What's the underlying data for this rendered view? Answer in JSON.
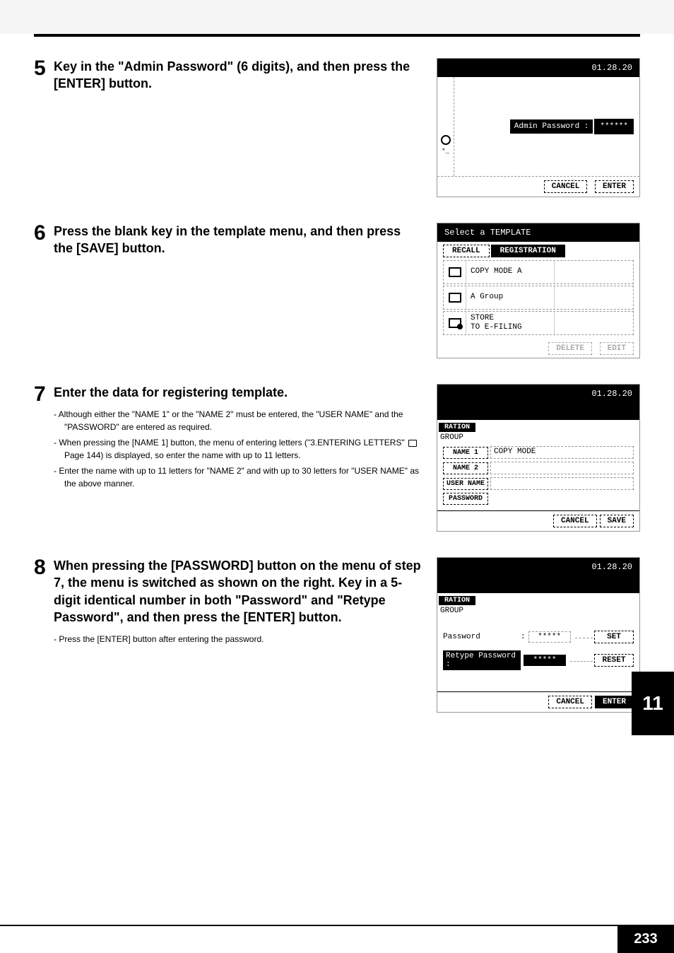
{
  "steps": {
    "5": {
      "num": "5",
      "title": "Key in the \"Admin Password\" (6 digits), and then press the [ENTER] button.",
      "screen": {
        "timestamp": "01.28.20",
        "label": "Admin Password :",
        "value": "******",
        "cancel": "CANCEL",
        "enter": "ENTER"
      }
    },
    "6": {
      "num": "6",
      "title": "Press the blank key in the template menu, and then press the [SAVE] button.",
      "screen": {
        "header": "Select a TEMPLATE",
        "tab_recall": "RECALL",
        "tab_registration": "REGISTRATION",
        "row1": "COPY MODE A",
        "row2": "A Group",
        "row3a": "STORE",
        "row3b": "TO E-FILING",
        "delete": "DELETE",
        "edit": "EDIT"
      }
    },
    "7": {
      "num": "7",
      "title": "Enter the data for registering template.",
      "bullets": {
        "b1": "Although either the \"NAME 1\" or the \"NAME 2\" must be entered, the \"USER NAME\" and the \"PASSWORD\" are entered as required.",
        "b2a": "When pressing the [NAME 1] button, the menu of entering letters (\"3.ENTERING LETTERS\" ",
        "b2b": " Page 144) is displayed, so enter the name with up to 11 letters.",
        "b3": "Enter the name with up to 11 letters for \"NAME 2\" and with up to 30 letters for \"USER NAME\" as the above manner."
      },
      "screen": {
        "timestamp": "01.28.20",
        "tab": "RATION",
        "group": "GROUP",
        "name1": "NAME 1",
        "name1_val": "COPY MODE",
        "name2": "NAME 2",
        "username": "USER NAME",
        "password": "PASSWORD",
        "cancel": "CANCEL",
        "save": "SAVE"
      }
    },
    "8": {
      "num": "8",
      "title": "When pressing the [PASSWORD] button on the menu of step 7, the menu is switched as shown on the right. Key in a 5-digit identical number in both \"Password\" and \"Retype Password\", and then press the [ENTER] button.",
      "bullet": "Press the [ENTER] button after entering the password.",
      "screen": {
        "timestamp": "01.28.20",
        "tab": "RATION",
        "group": "GROUP",
        "pw_label": "Password",
        "pw_sep": ":",
        "pw_val": "*****",
        "set": "SET",
        "retype_label": "Retype Password :",
        "retype_val": "*****",
        "reset": "RESET",
        "cancel": "CANCEL",
        "enter": "ENTER"
      }
    }
  },
  "sidebar_chapter": "11",
  "page_number": "233"
}
